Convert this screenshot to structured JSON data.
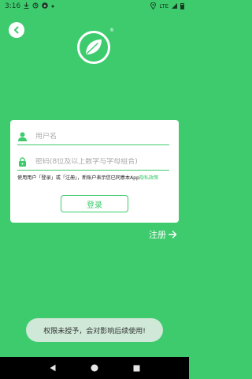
{
  "status_bar": {
    "time": "3:16",
    "network": "LTE",
    "icons": [
      "download-icon",
      "sync-icon",
      "ebook-icon",
      "dot-icon",
      "location-icon",
      "signal-icon",
      "battery-icon"
    ]
  },
  "header": {
    "back_icon": "chevron-left-icon",
    "logo_icon": "leaf-logo-icon",
    "logo_mark": "®"
  },
  "login_card": {
    "username_placeholder": "用户名",
    "password_placeholder": "密码(8位及以上数字与字母组合)",
    "agreement_prefix": "使用用户「登录」或「注册」，新账户表示您已同意本App",
    "agreement_link": "隐私政策",
    "login_label": "登录"
  },
  "register": {
    "label": "注册",
    "arrow": "→"
  },
  "toast": {
    "message": "权限未授予，会对影响后续使用!"
  },
  "nav_bar": {
    "back": "back-triangle-icon",
    "home": "home-circle-icon",
    "recents": "recents-square-icon"
  },
  "colors": {
    "brand_green": "#3ecb6d",
    "card": "#ffffff",
    "toast_bg": "#cfe8d8",
    "nav_bg": "#000000"
  }
}
